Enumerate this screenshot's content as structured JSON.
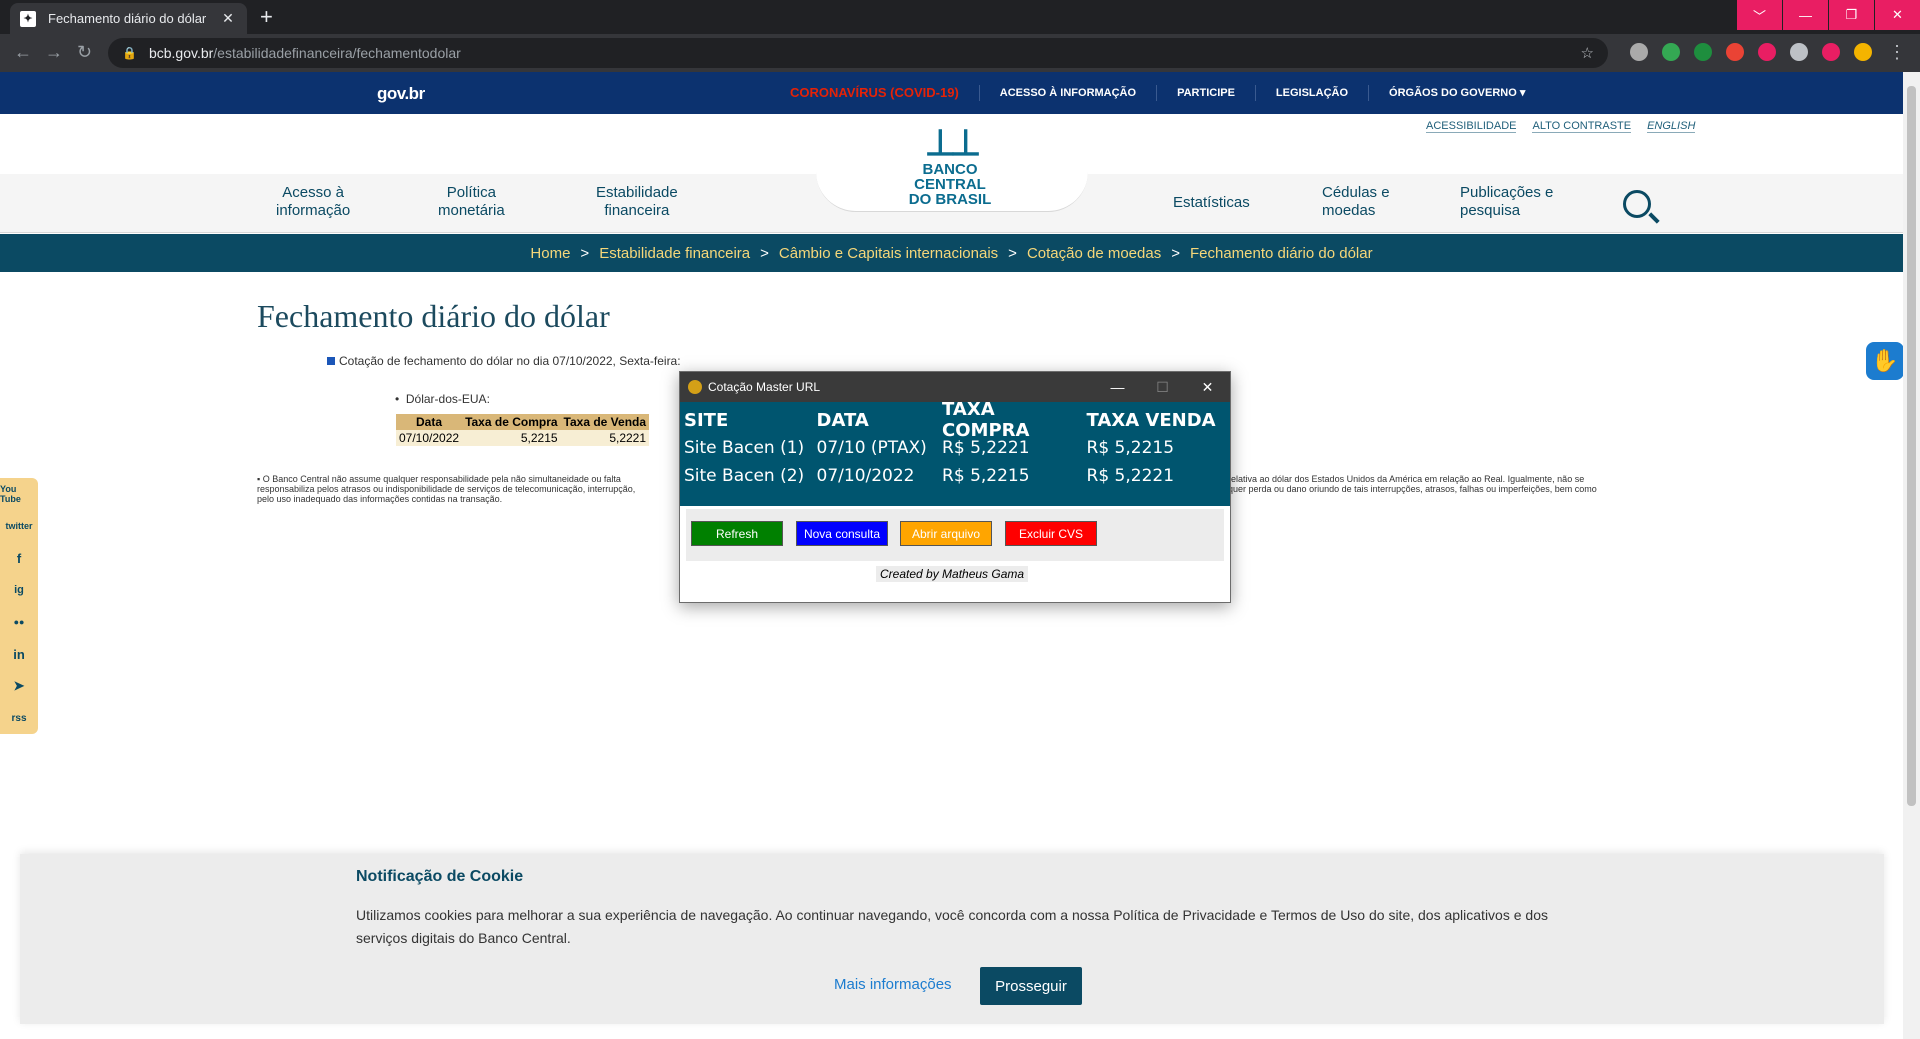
{
  "browser": {
    "tab_title": "Fechamento diário do dólar",
    "tab_close": "✕",
    "new_tab": "+",
    "url_host": "bcb.gov.br",
    "url_path": "/estabilidadefinanceira/fechamentodolar",
    "window_buttons": [
      "﹀",
      "—",
      "❐",
      "✕"
    ]
  },
  "govbar": {
    "logo": "gov.br",
    "links": [
      "CORONAVÍRUS (COVID-19)",
      "ACESSO À INFORMAÇÃO",
      "PARTICIPE",
      "LEGISLAÇÃO",
      "ÓRGÃOS DO GOVERNO ▾"
    ]
  },
  "header": {
    "utilities": [
      "ACESSIBILIDADE",
      "ALTO CONTRASTE",
      "ENGLISH"
    ],
    "logo_name_1": "BANCO CENTRAL",
    "logo_name_2": "DO BRASIL",
    "menu": [
      {
        "line1": "Acesso à",
        "line2": "informação"
      },
      {
        "line1": "Política",
        "line2": "monetária"
      },
      {
        "line1": "Estabilidade",
        "line2": "financeira"
      },
      {
        "line1": "Estatísticas",
        "line2": ""
      },
      {
        "line1": "Cédulas e",
        "line2": "moedas"
      },
      {
        "line1": "Publicações e",
        "line2": "pesquisa"
      }
    ]
  },
  "breadcrumb": [
    "Home",
    "Estabilidade financeira",
    "Câmbio e Capitais internacionais",
    "Cotação de moedas",
    "Fechamento diário do dólar"
  ],
  "page": {
    "title": "Fechamento diário do dólar",
    "cotacao_line": "Cotação de fechamento do dólar no dia 07/10/2022, Sexta-feira:",
    "dolar_label": "Dólar-dos-EUA:",
    "table_headers": [
      "Data",
      "Taxa de Compra",
      "Taxa de Venda"
    ],
    "table_row": [
      "07/10/2022",
      "5,2215",
      "5,2221"
    ],
    "disclaimer_left": "O Banco Central não assume qualquer responsabilidade pela não simultaneidade ou falta",
    "disclaimer_left_2": "responsabiliza pelos atrasos ou indisponibilidade de serviços de telecomunicação, interrupção,",
    "disclaimer_left_3": "pelo uso inadequado das informações contidas na transação.",
    "disclaimer_right": "relativa ao dólar dos Estados Unidos da América em relação ao Real. Igualmente, não se",
    "disclaimer_right_2": "quer perda ou dano oriundo de tais interrupções, atrasos, falhas ou imperfeições, bem como"
  },
  "social": [
    "You Tube",
    "twitter",
    "f",
    "ig",
    "●●",
    "in",
    "➤",
    "rss"
  ],
  "app": {
    "title": "Cotação Master URL",
    "win_min": "—",
    "win_max": "☐",
    "win_close": "✕",
    "headers": [
      "SITE",
      "DATA",
      "TAXA COMPRA",
      "TAXA VENDA"
    ],
    "rows": [
      [
        "Site Bacen (1)",
        "07/10 (PTAX)",
        "R$ 5,2221",
        "R$ 5,2215"
      ],
      [
        "Site Bacen (2)",
        "07/10/2022",
        "R$ 5,2215",
        "R$ 5,2221"
      ]
    ],
    "buttons": [
      {
        "label": "Refresh",
        "bg": "#008000",
        "fg": "#ffffff"
      },
      {
        "label": "Nova consulta",
        "bg": "#0000ff",
        "fg": "#ffffff"
      },
      {
        "label": "Abrir arquivo",
        "bg": "#ffa500",
        "fg": "#ffffff"
      },
      {
        "label": "Excluir CVS",
        "bg": "#ff0000",
        "fg": "#ffffff"
      }
    ],
    "credit": "Created by Matheus Gama"
  },
  "cookie": {
    "title": "Notificação de Cookie",
    "body": "Utilizamos cookies para melhorar a sua experiência de navegação. Ao continuar navegando, você concorda com a nossa Política de Privacidade e Termos de Uso do site, dos aplicativos e dos serviços digitais do Banco Central.",
    "more": "Mais informações",
    "accept": "Prosseguir"
  }
}
